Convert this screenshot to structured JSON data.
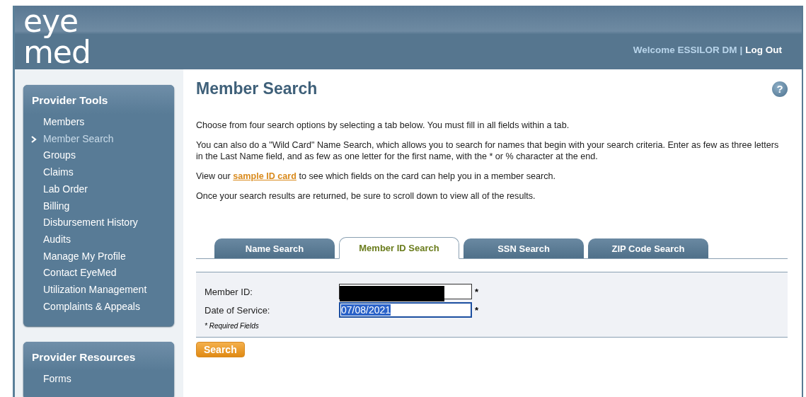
{
  "header": {
    "logo": [
      "eye",
      "med"
    ],
    "welcome": "Welcome ESSILOR DM",
    "separator": "|",
    "logout": "Log Out"
  },
  "sidebar": [
    {
      "title": "Provider Tools",
      "items": [
        {
          "label": "Members",
          "selected": false
        },
        {
          "label": "Member Search",
          "selected": true
        },
        {
          "label": "Groups",
          "selected": false
        },
        {
          "label": "Claims",
          "selected": false
        },
        {
          "label": "Lab Order",
          "selected": false
        },
        {
          "label": "Billing",
          "selected": false
        },
        {
          "label": "Disbursement History",
          "selected": false
        },
        {
          "label": "Audits",
          "selected": false
        },
        {
          "label": "Manage My Profile",
          "selected": false
        },
        {
          "label": "Contact EyeMed",
          "selected": false
        },
        {
          "label": "Utilization Management",
          "selected": false
        },
        {
          "label": "Complaints & Appeals",
          "selected": false
        }
      ]
    },
    {
      "title": "Provider Resources",
      "items": [
        {
          "label": "Forms",
          "selected": false
        }
      ]
    }
  ],
  "main": {
    "title": "Member Search",
    "help": "?",
    "paragraphs": [
      {
        "text": "Choose  from four search options by selecting a tab below. You must fill in all fields within a tab."
      },
      {
        "text": "You can also do a \"Wild Card\" Name Search, which  allows you to search for names that begin with your search criteria. Enter as few as three letters in the Last Name field, and as few as one letter for the first name, with the * or % character at the end."
      },
      {
        "before": "View our ",
        "link": "sample ID card",
        "after": " to see which fields on the card can help you in a member search."
      },
      {
        "text": "Once your search results are returned, be sure to scroll down to view all of the results."
      }
    ],
    "tabs": [
      {
        "label": "Name Search",
        "selected": false
      },
      {
        "label": "Member ID Search",
        "selected": true
      },
      {
        "label": "SSN Search",
        "selected": false
      },
      {
        "label": "ZIP Code Search",
        "selected": false
      }
    ],
    "fields": [
      {
        "label": "Member ID:",
        "redacted": true,
        "text_selected": false,
        "required": "*"
      },
      {
        "label": "Date of Service:",
        "value": "07/08/2021",
        "redacted": false,
        "text_selected": true,
        "required": "*"
      }
    ],
    "note": "* Required Fields",
    "button": "Search"
  }
}
